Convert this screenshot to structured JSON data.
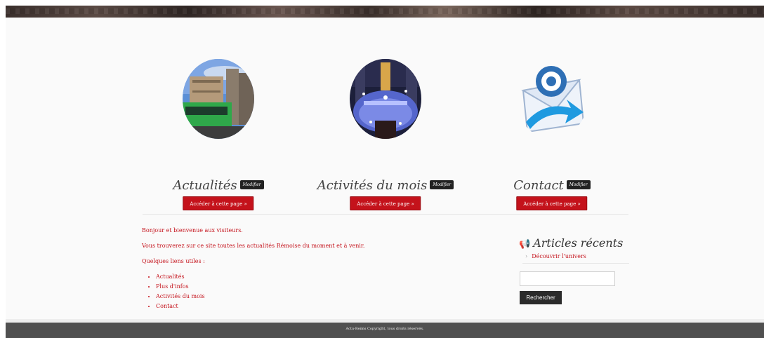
{
  "features": [
    {
      "title": "Actualités",
      "edit_label": "Modifier",
      "button_label": "Accéder à cette page »"
    },
    {
      "title": "Activités du mois",
      "edit_label": "Modifier",
      "button_label": "Accéder à cette page »"
    },
    {
      "title": "Contact",
      "edit_label": "Modifier",
      "button_label": "Accéder à cette page »"
    }
  ],
  "intro": {
    "welcome": "Bonjour et bienvenue aux visiteurs.",
    "description": "Vous trouverez sur ce site toutes les actualités Rémoise du moment et à venir.",
    "links_heading": "Quelques liens utiles :",
    "links": [
      "Actualités",
      "Plus d'infos",
      "Activités du mois",
      "Contact"
    ]
  },
  "sidebar": {
    "title": "Articles récents",
    "icon": "megaphone-icon",
    "recent_articles": [
      "Découvrir l'univers"
    ],
    "search_value": "",
    "search_button": "Rechercher"
  },
  "footer": {
    "copyright": "Actu-Reims Copyright, tous droits réservés."
  },
  "colors": {
    "accent": "#c4121b",
    "footer_bg": "#505050",
    "page_bg": "#fafafa"
  }
}
